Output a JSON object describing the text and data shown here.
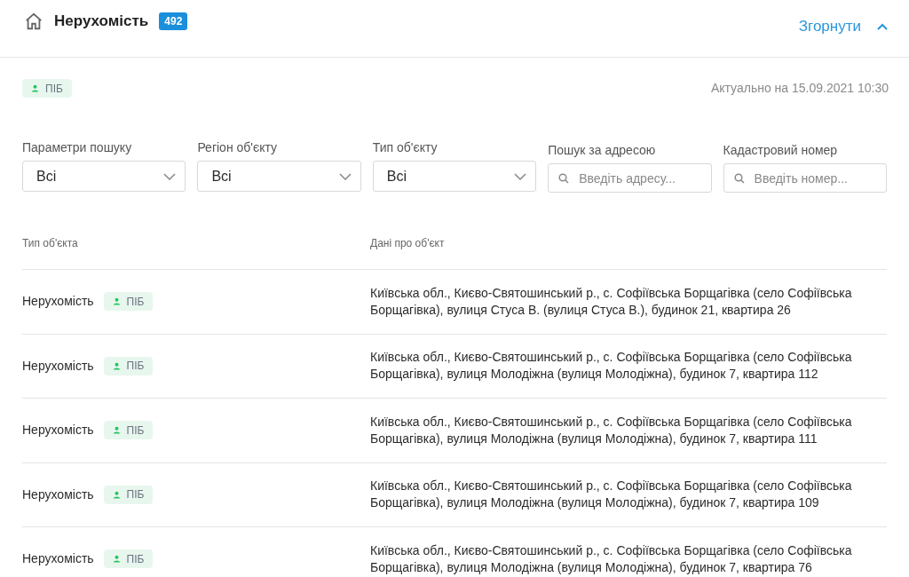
{
  "header": {
    "title": "Нерухомість",
    "count": "492",
    "collapse_label": "Згорнути"
  },
  "source_tag": "ПІБ",
  "updated": "Актуально на 15.09.2021 10:30",
  "filters": [
    {
      "kind": "select",
      "label": "Параметри пошуку",
      "value": "Всі"
    },
    {
      "kind": "select",
      "label": "Регіон об'єкту",
      "value": "Всі"
    },
    {
      "kind": "select",
      "label": "Тип об'єкту",
      "value": "Всі"
    },
    {
      "kind": "search",
      "label": "Пошук за адресою",
      "placeholder": "Введіть адресу..."
    },
    {
      "kind": "search",
      "label": "Кадастровий номер",
      "placeholder": "Введіть номер..."
    }
  ],
  "table": {
    "columns": [
      "Тип об'єкта",
      "Дані про об'єкт"
    ],
    "rows": [
      {
        "type": "Нерухомість",
        "tag": "ПІБ",
        "details": "Київська обл., Києво-Святошинський р., с. Софіївська Борщагівка (село Софіївська Борщагівка), вулиця Стуса В. (вулиця Стуса В.), будинок 21, квартира 26"
      },
      {
        "type": "Нерухомість",
        "tag": "ПІБ",
        "details": "Київська обл., Києво-Святошинський р., с. Софіївська Борщагівка (село Софіївська Борщагівка), вулиця Молодіжна (вулиця Молодіжна), будинок 7, квартира 112"
      },
      {
        "type": "Нерухомість",
        "tag": "ПІБ",
        "details": "Київська обл., Києво-Святошинський р., с. Софіївська Борщагівка (село Софіївська Борщагівка), вулиця Молодіжна (вулиця Молодіжна), будинок 7, квартира 111"
      },
      {
        "type": "Нерухомість",
        "tag": "ПІБ",
        "details": "Київська обл., Києво-Святошинський р., с. Софіївська Борщагівка (село Софіївська Борщагівка), вулиця Молодіжна (вулиця Молодіжна), будинок 7, квартира 109"
      },
      {
        "type": "Нерухомість",
        "tag": "ПІБ",
        "details": "Київська обл., Києво-Святошинський р., с. Софіївська Борщагівка (село Софіївська Борщагівка), вулиця Молодіжна (вулиця Молодіжна), будинок 7, квартира 76"
      }
    ]
  }
}
